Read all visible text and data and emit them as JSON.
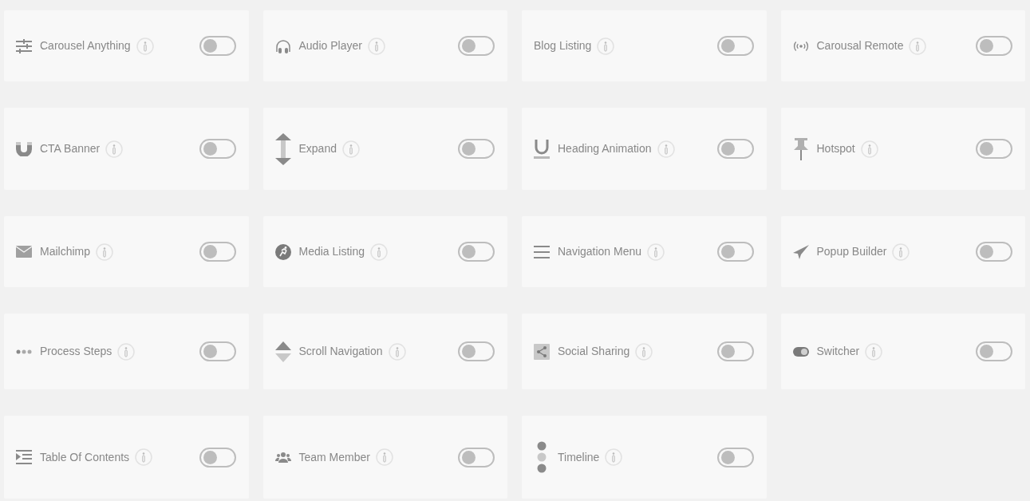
{
  "widgets": [
    {
      "label": "Carousel Anything",
      "kind": "sliders",
      "on": false
    },
    {
      "label": "Audio Player",
      "kind": "headphones",
      "on": false
    },
    {
      "label": "Blog Listing",
      "kind": "plain",
      "on": false
    },
    {
      "label": "Carousal Remote",
      "kind": "broadcast",
      "on": false
    },
    {
      "label": "CTA Banner",
      "kind": "magnet",
      "on": false
    },
    {
      "label": "Expand",
      "kind": "expand",
      "on": false
    },
    {
      "label": "Heading Animation",
      "kind": "underline",
      "on": false
    },
    {
      "label": "Hotspot",
      "kind": "pin",
      "on": false
    },
    {
      "label": "Mailchimp",
      "kind": "envelope",
      "on": false
    },
    {
      "label": "Media Listing",
      "kind": "runner",
      "on": false
    },
    {
      "label": "Navigation Menu",
      "kind": "menu",
      "on": false
    },
    {
      "label": "Popup Builder",
      "kind": "plane",
      "on": false
    },
    {
      "label": "Process Steps",
      "kind": "dots",
      "on": false
    },
    {
      "label": "Scroll Navigation",
      "kind": "updown",
      "on": false
    },
    {
      "label": "Social Sharing",
      "kind": "share",
      "on": false
    },
    {
      "label": "Switcher",
      "kind": "toggle",
      "on": false
    },
    {
      "label": "Table Of Contents",
      "kind": "toc",
      "on": false
    },
    {
      "label": "Team Member",
      "kind": "team",
      "on": false
    },
    {
      "label": "Timeline",
      "kind": "timeline",
      "on": false
    }
  ]
}
